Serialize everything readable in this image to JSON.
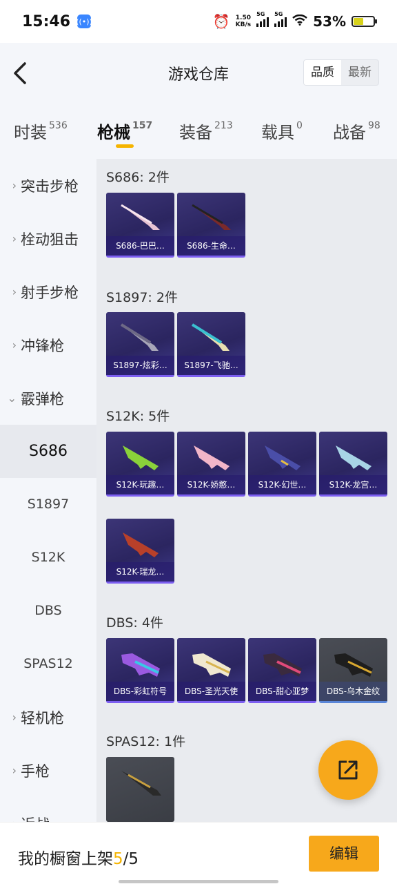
{
  "status": {
    "time": "15:46",
    "speed": "1.50",
    "speed_unit": "KB/s",
    "net1": "5G",
    "net2": "5G",
    "battery": "53%"
  },
  "header": {
    "title": "游戏仓库",
    "sort": [
      "品质",
      "最新"
    ]
  },
  "tabs": [
    {
      "label": "时装",
      "count": "536"
    },
    {
      "label": "枪械",
      "count": "157"
    },
    {
      "label": "装备",
      "count": "213"
    },
    {
      "label": "载具",
      "count": "0"
    },
    {
      "label": "战备",
      "count": "98"
    }
  ],
  "sidebar": {
    "categories": [
      "突击步枪",
      "栓动狙击",
      "射手步枪",
      "冲锋枪",
      "霰弹枪",
      "轻机枪",
      "手枪",
      "近战"
    ],
    "subitems": [
      "S686",
      "S1897",
      "S12K",
      "DBS",
      "SPAS12"
    ]
  },
  "groups": [
    {
      "title": "S686: 2件",
      "items": [
        "S686-巴巴…",
        "S686-生命…"
      ]
    },
    {
      "title": "S1897: 2件",
      "items": [
        "S1897-炫彩…",
        "S1897-飞驰…"
      ]
    },
    {
      "title": "S12K: 5件",
      "items": [
        "S12K-玩趣…",
        "S12K-娇憨…",
        "S12K-幻世…",
        "S12K-龙宫…",
        "S12K-瑞龙…"
      ]
    },
    {
      "title": "DBS: 4件",
      "items": [
        "DBS-彩虹符号",
        "DBS-圣光天使",
        "DBS-甜心亚梦",
        "DBS-乌木金纹"
      ]
    },
    {
      "title": "SPAS12: 1件",
      "items": []
    }
  ],
  "bottom": {
    "label": "我的橱窗上架",
    "current": "5",
    "sep": "/",
    "total": "5",
    "edit": "编辑"
  }
}
